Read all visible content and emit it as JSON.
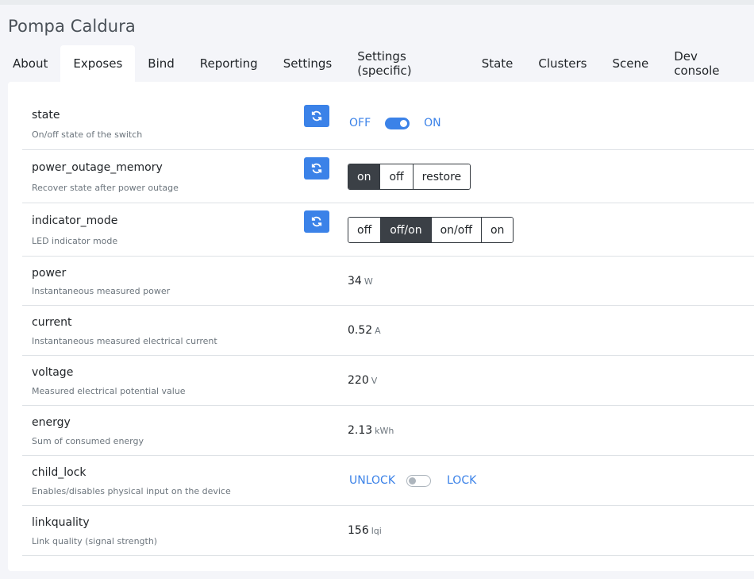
{
  "device": {
    "title": "Pompa Caldura"
  },
  "tabs": [
    {
      "label": "About"
    },
    {
      "label": "Exposes"
    },
    {
      "label": "Bind"
    },
    {
      "label": "Reporting"
    },
    {
      "label": "Settings"
    },
    {
      "label": "Settings (specific)"
    },
    {
      "label": "State"
    },
    {
      "label": "Clusters"
    },
    {
      "label": "Scene"
    },
    {
      "label": "Dev console"
    }
  ],
  "active_tab": "Exposes",
  "rows": {
    "state": {
      "name": "state",
      "desc": "On/off state of the switch",
      "off_label": "OFF",
      "on_label": "ON",
      "value": "ON"
    },
    "power_outage_memory": {
      "name": "power_outage_memory",
      "desc": "Recover state after power outage",
      "options": [
        "on",
        "off",
        "restore"
      ],
      "selected": "on"
    },
    "indicator_mode": {
      "name": "indicator_mode",
      "desc": "LED indicator mode",
      "options": [
        "off",
        "off/on",
        "on/off",
        "on"
      ],
      "selected": "off/on"
    },
    "power": {
      "name": "power",
      "desc": "Instantaneous measured power",
      "value": "34",
      "unit": "W"
    },
    "current": {
      "name": "current",
      "desc": "Instantaneous measured electrical current",
      "value": "0.52",
      "unit": "A"
    },
    "voltage": {
      "name": "voltage",
      "desc": "Measured electrical potential value",
      "value": "220",
      "unit": "V"
    },
    "energy": {
      "name": "energy",
      "desc": "Sum of consumed energy",
      "value": "2.13",
      "unit": "kWh"
    },
    "child_lock": {
      "name": "child_lock",
      "desc": "Enables/disables physical input on the device",
      "off_label": "UNLOCK",
      "on_label": "LOCK",
      "value": "UNLOCK"
    },
    "linkquality": {
      "name": "linkquality",
      "desc": "Link quality (signal strength)",
      "value": "156",
      "unit": "lqi"
    }
  },
  "colors": {
    "accent": "#3b82e8",
    "active_segment": "#3b4046",
    "page_bg": "#f4f5f9"
  },
  "icons": {
    "refresh": "refresh-icon"
  }
}
